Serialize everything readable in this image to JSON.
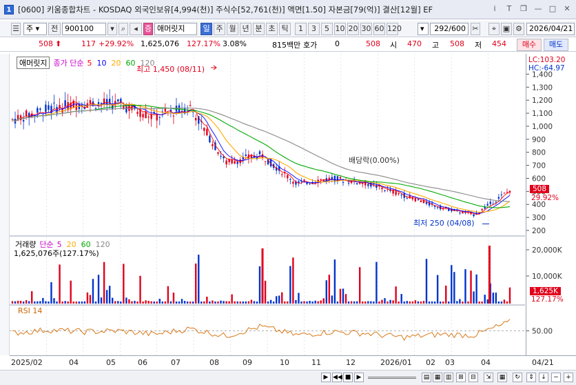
{
  "window": {
    "icon_label": "1",
    "title": "[0600] 키움종합차트 - KOSDAQ 외국인보유[4,994(천)] 주식수[52,761(천)] 액면[1.50] 자본금[79(억)] 결산[12월] EF"
  },
  "toolbar": {
    "market": "주",
    "prev": "전",
    "code": "900100",
    "stock_name": "애머릿지",
    "period_tabs": [
      "일",
      "주",
      "월",
      "년",
      "분",
      "초",
      "틱"
    ],
    "active_period": "일",
    "intervals": [
      "1",
      "3",
      "5",
      "10",
      "20",
      "30",
      "60",
      "120"
    ],
    "range": "292/600",
    "date": "2026/04/21"
  },
  "quote": {
    "price": "508",
    "change": "117",
    "change_pct": "+29.92%",
    "volume": "1,625,076",
    "volume_pct": "127.17%",
    "turnover_pct": "3.08%",
    "amount": "815백만",
    "ask_label": "호가",
    "ask_value": "0",
    "current": "508",
    "open_label": "시",
    "open": "470",
    "high_label": "고",
    "high": "508",
    "low_label": "저",
    "low": "454",
    "buy_label": "매수",
    "sell_label": "매도"
  },
  "price_panel": {
    "name": "애머릿지",
    "ma_label": "종가 단순",
    "ma_periods": [
      "5",
      "10",
      "20",
      "60",
      "120"
    ],
    "ma_colors": [
      "#ff0000",
      "#0000ff",
      "#ffaa00",
      "#00aa00",
      "#888888"
    ],
    "lc": "LC:103.20",
    "hc": "HC:-64.97",
    "high_note": "최고 1,450 (08/11)",
    "low_note": "최저 250 (04/08)",
    "dividend_note": "배당락(0.00%)",
    "last_price": "508",
    "last_pct": "29.92%",
    "yticks": [
      "1,400",
      "1,300",
      "1,200",
      "1,100",
      "1,000",
      "900",
      "800",
      "700",
      "600",
      "500",
      "400",
      "300",
      "200"
    ]
  },
  "volume_panel": {
    "name": "거래량",
    "ma_label": "단순",
    "ma_periods": [
      "5",
      "20",
      "60",
      "120"
    ],
    "info": "1,625,076주(127.17%)",
    "last_value": "1,625K",
    "last_pct": "127.17%",
    "yticks": [
      "20,000K",
      "10,000K"
    ]
  },
  "rsi_panel": {
    "name": "RSI 14",
    "ytick": "50.00"
  },
  "xaxis": {
    "labels": [
      "2025/02",
      "04",
      "05",
      "06",
      "07",
      "08",
      "09",
      "10",
      "11",
      "12",
      "2026/01",
      "02",
      "03",
      "04"
    ],
    "right_label": "04/21"
  },
  "colors": {
    "up": "#e0001b",
    "down": "#0033cc",
    "grid": "#cfd3dc"
  },
  "chart_data": {
    "type": "line",
    "title": "애머릿지",
    "ylabel": "",
    "xlabel": "",
    "x": [
      "2025/02",
      "04",
      "05",
      "06",
      "07",
      "08",
      "09",
      "10",
      "11",
      "12",
      "2026/01",
      "02",
      "03",
      "04",
      "04/21"
    ],
    "ylim": [
      200,
      1450
    ],
    "series": [
      {
        "name": "종가",
        "values": [
          1050,
          1130,
          1180,
          1170,
          1070,
          1150,
          720,
          780,
          560,
          600,
          560,
          470,
          380,
          320,
          508
        ]
      }
    ],
    "volume": {
      "name": "거래량",
      "ylim": [
        0,
        22000
      ],
      "peaks_k": [
        {
          "x": "10",
          "value": 20000
        },
        {
          "x": "04",
          "value": 21000
        }
      ]
    },
    "rsi": {
      "name": "RSI 14",
      "ylim": [
        0,
        100
      ],
      "values": [
        45,
        52,
        48,
        50,
        42,
        55,
        38,
        60,
        40,
        48,
        44,
        35,
        42,
        40,
        70
      ]
    }
  }
}
